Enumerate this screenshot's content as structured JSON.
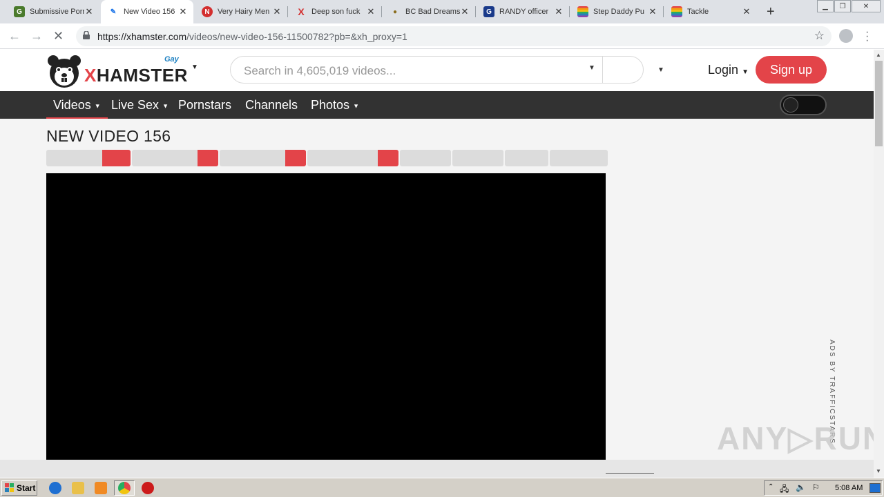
{
  "browser": {
    "tabs": [
      {
        "title": "Submissive Porn",
        "favicon": "G",
        "favicon_color": "#4a7a2c"
      },
      {
        "title": "New Video 156",
        "favicon": "✎",
        "favicon_color": "#1a73e8"
      },
      {
        "title": "Very Hairy Men",
        "favicon": "N",
        "favicon_color": "#d32f2f"
      },
      {
        "title": "Deep son fuck",
        "favicon": "X",
        "favicon_color": "#d32f2f"
      },
      {
        "title": "BC Bad Dreams",
        "favicon": "●",
        "favicon_color": "#333333"
      },
      {
        "title": "RANDY officer",
        "favicon": "G",
        "favicon_color": "#1a3a8a"
      },
      {
        "title": "Step Daddy Pu",
        "favicon": "🏳",
        "favicon_color": "#e34449"
      },
      {
        "title": "Tackle",
        "favicon": "🏳",
        "favicon_color": "#e34449"
      }
    ],
    "active_tab": 1,
    "url_host": "https://xhamster.com",
    "url_path": "/videos/new-video-156-11500782?pb=&xh_proxy=1"
  },
  "site": {
    "logo_text_x": "X",
    "logo_text_rest": "HAMSTER",
    "logo_sub": "Gay",
    "search_placeholder": "Search in 4,605,019 videos...",
    "login_label": "Login",
    "signup_label": "Sign up",
    "accent_color": "#e34449",
    "nav": [
      {
        "label": "Videos",
        "has_caret": true
      },
      {
        "label": "Live Sex",
        "has_caret": true
      },
      {
        "label": "Pornstars",
        "has_caret": false
      },
      {
        "label": "Channels",
        "has_caret": false
      },
      {
        "label": "Photos",
        "has_caret": true
      }
    ]
  },
  "page": {
    "title": "NEW VIDEO 156",
    "ads_label": "ADS BY TRAFFICSTARS",
    "watermark": "ANY▷RUN"
  },
  "taskbar": {
    "start_label": "Start",
    "clock": "5:08 AM"
  }
}
